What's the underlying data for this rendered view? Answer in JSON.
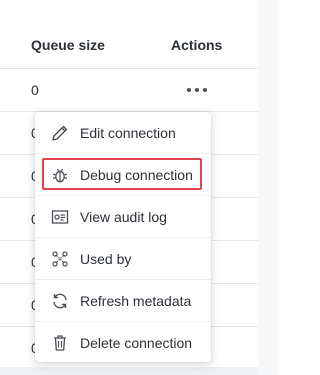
{
  "table": {
    "columns": {
      "queue_size": "Queue size",
      "actions": "Actions"
    },
    "rows": [
      {
        "queue_size": "0"
      },
      {
        "queue_size": "0"
      },
      {
        "queue_size": "0"
      },
      {
        "queue_size": "0"
      },
      {
        "queue_size": "0"
      },
      {
        "queue_size": "0"
      },
      {
        "queue_size": "0"
      }
    ]
  },
  "menu": {
    "items": [
      {
        "label": "Edit connection",
        "icon": "pencil-icon"
      },
      {
        "label": "Debug connection",
        "icon": "bug-icon",
        "highlighted": true
      },
      {
        "label": "View audit log",
        "icon": "audit-log-icon"
      },
      {
        "label": "Used by",
        "icon": "used-by-icon"
      },
      {
        "label": "Refresh metadata",
        "icon": "refresh-icon"
      },
      {
        "label": "Delete connection",
        "icon": "trash-icon"
      }
    ]
  },
  "colors": {
    "highlight": "#e0444e",
    "text": "#2b2f36",
    "border": "#e4e7ec"
  }
}
